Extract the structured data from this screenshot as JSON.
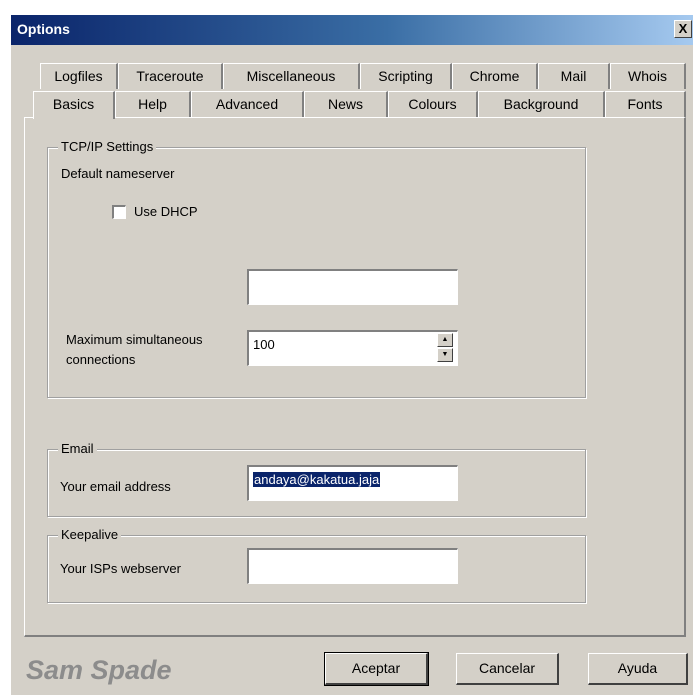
{
  "window": {
    "title": "Options",
    "close_label": "X"
  },
  "tabs_row1": [
    "Logfiles",
    "Traceroute",
    "Miscellaneous",
    "Scripting",
    "Chrome",
    "Mail",
    "Whois"
  ],
  "tabs_row2": [
    "Basics",
    "Help",
    "Advanced",
    "News",
    "Colours",
    "Background",
    "Fonts"
  ],
  "active_tab": "Basics",
  "tcpip": {
    "legend": "TCP/IP Settings",
    "nameserver_label": "Default nameserver",
    "use_dhcp_label": "Use DHCP",
    "use_dhcp_checked": false,
    "nameserver_value": "",
    "max_conn_label_line1": "Maximum simultaneous",
    "max_conn_label_line2": "connections",
    "max_conn_value": "100"
  },
  "email": {
    "legend": "Email",
    "address_label": "Your email address",
    "address_value": "andaya@kakatua.jaja"
  },
  "keepalive": {
    "legend": "Keepalive",
    "webserver_label": "Your ISPs webserver",
    "webserver_value": ""
  },
  "footer": {
    "brand": "Sam Spade",
    "ok_label": "Aceptar",
    "cancel_label": "Cancelar",
    "help_label": "Ayuda"
  },
  "colors": {
    "dialog_bg": "#d4d0c8",
    "titlebar_start": "#0a246a",
    "selection": "#0a246a"
  }
}
